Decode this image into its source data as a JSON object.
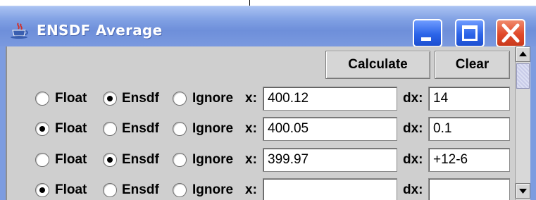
{
  "window": {
    "title": "ENSDF Average",
    "buttons": {
      "minimize": "minimize",
      "maximize": "maximize",
      "close": "close"
    }
  },
  "toolbar": {
    "calculate_label": "Calculate",
    "clear_label": "Clear"
  },
  "labels": {
    "float": "Float",
    "ensdf": "Ensdf",
    "ignore": "Ignore",
    "x": "x:",
    "dx": "dx:"
  },
  "rows": [
    {
      "mode": "Ensdf",
      "x": "400.12",
      "dx": "14"
    },
    {
      "mode": "Float",
      "x": "400.05",
      "dx": "0.1"
    },
    {
      "mode": "Ensdf",
      "x": "399.97",
      "dx": "+12-6"
    },
    {
      "mode": "Float",
      "x": "",
      "dx": ""
    }
  ],
  "icons": {
    "app": "java-cup-icon",
    "scroll_up": "arrow-up-icon",
    "scroll_down": "arrow-down-icon"
  },
  "colors": {
    "titlebar": "#7f9fe3",
    "close_button": "#e0492a",
    "panel": "#cfcfcf"
  }
}
